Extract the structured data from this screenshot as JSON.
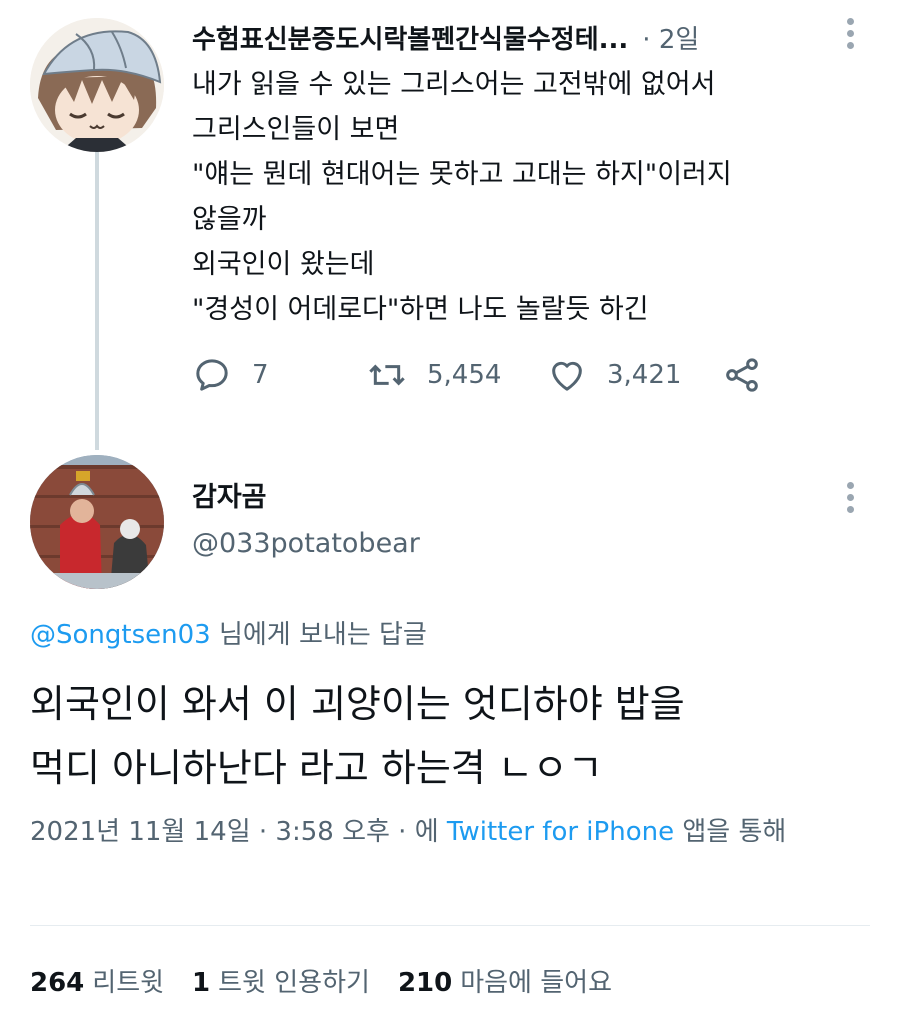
{
  "parent_tweet": {
    "display_name": "수험표신분증도시락볼펜간식물수정테...",
    "time_sep": "·",
    "time": "2일",
    "text_lines": [
      "내가 읽을 수 있는 그리스어는 고전밖에 없어서",
      "그리스인들이 보면",
      "\"얘는 뭔데 현대어는 못하고 고대는 하지\"이러지",
      "않을까",
      "외국인이 왔는데",
      "\"경성이 어데로다\"하면 나도 놀랄듯 하긴"
    ],
    "actions": {
      "reply_count": "7",
      "retweet_count": "5,454",
      "like_count": "3,421"
    }
  },
  "main_tweet": {
    "display_name": "감자곰",
    "handle": "@033potatobear",
    "reply_mention": "@Songtsen03",
    "reply_suffix": " 님에게 보내는 답글",
    "text_lines": [
      "외국인이 와서 이 괴양이는 엇디하야 밥을",
      "먹디 아니하난다 라고 하는격 ㄴㅇㄱ"
    ],
    "meta_prefix": "2021년 11월 14일 · 3:58 오후 · 에 ",
    "meta_app": "Twitter for iPhone",
    "meta_suffix": " 앱을 통해",
    "stats": {
      "retweets_count": "264",
      "retweets_label": "리트윗",
      "quotes_count": "1",
      "quotes_label": "트윗 인용하기",
      "likes_count": "210",
      "likes_label": "마음에 들어요"
    }
  },
  "colors": {
    "text": "#0f1419",
    "secondary": "#536471",
    "link": "#1d9bf0",
    "thread_line": "#cfd9de"
  },
  "icons": [
    "reply-icon",
    "retweet-icon",
    "heart-icon",
    "share-icon",
    "more-options-icon"
  ]
}
